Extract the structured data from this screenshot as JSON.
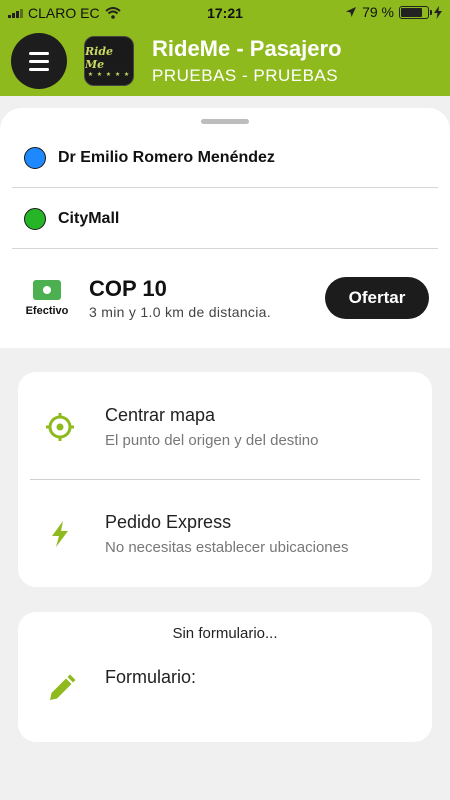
{
  "status_bar": {
    "carrier": "CLARO EC",
    "time": "17:21",
    "battery": "79 %",
    "battery_level": 0.79,
    "signal_icon": "signal-icon",
    "wifi_icon": "wifi-icon",
    "location_icon": "location-arrow-icon",
    "charging_icon": "charging-bolt-icon"
  },
  "header": {
    "menu_icon": "hamburger-icon",
    "logo_text": "Ride Me",
    "title": "RideMe - Pasajero",
    "subtitle": "PRUEBAS - PRUEBAS",
    "color": "#8fba1d"
  },
  "trip": {
    "origin": "Dr Emilio Romero Menéndez",
    "destination": "CityMall",
    "origin_color": "#1e88ff",
    "destination_color": "#26b526",
    "payment_method": "Efectivo",
    "payment_icon": "cash-icon",
    "price": "COP 10",
    "info": "3 min y 1.0 km de distancia.",
    "offer_button": "Ofertar"
  },
  "actions": [
    {
      "icon": "crosshair-icon",
      "title": "Centrar mapa",
      "description": "El punto del origen y del destino"
    },
    {
      "icon": "bolt-icon",
      "title": "Pedido Express",
      "description": "No necesitas establecer ubicaciones"
    }
  ],
  "form": {
    "heading": "Sin formulario...",
    "icon": "pencil-icon",
    "label": "Formulario:"
  },
  "accent_color": "#8fba1d"
}
